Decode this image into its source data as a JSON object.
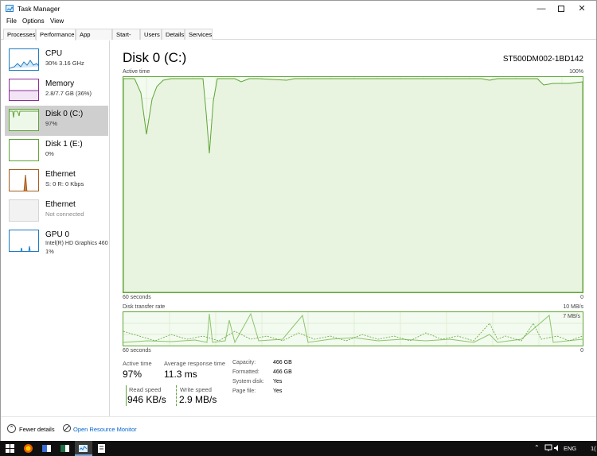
{
  "window": {
    "title": "Task Manager"
  },
  "menu": {
    "file": "File",
    "options": "Options",
    "view": "View"
  },
  "tabs": [
    "Processes",
    "Performance",
    "App history",
    "Start-up",
    "Users",
    "Details",
    "Services"
  ],
  "sidebar": {
    "items": [
      {
        "name": "CPU",
        "sub": "30%  3.16 GHz",
        "sub2": ""
      },
      {
        "name": "Memory",
        "sub": "2.8/7.7 GB (36%)",
        "sub2": ""
      },
      {
        "name": "Disk 0 (C:)",
        "sub": "97%",
        "sub2": ""
      },
      {
        "name": "Disk 1 (E:)",
        "sub": "0%",
        "sub2": ""
      },
      {
        "name": "Ethernet",
        "sub": "S: 0 R: 0 Kbps",
        "sub2": ""
      },
      {
        "name": "Ethernet",
        "sub": "Not connected",
        "sub2": ""
      },
      {
        "name": "GPU 0",
        "sub": "Intel(R) HD Graphics 460",
        "sub2": "1%"
      }
    ]
  },
  "main": {
    "title": "Disk 0 (C:)",
    "model": "ST500DM002-1BD142",
    "active_label": "Active time",
    "active_max": "100%",
    "seconds_left": "60 seconds",
    "zero": "0",
    "transfer_label": "Disk transfer rate",
    "transfer_max": "10 MB/s",
    "transfer_mid": "7 MB/s",
    "stats": {
      "active_time_label": "Active time",
      "active_time_value": "97%",
      "avg_response_label": "Average response time",
      "avg_response_value": "11.3 ms",
      "read_label": "Read speed",
      "read_value": "946 KB/s",
      "write_label": "Write speed",
      "write_value": "2.9 MB/s"
    },
    "specs": {
      "capacity_label": "Capacity:",
      "capacity_value": "466 GB",
      "formatted_label": "Formatted:",
      "formatted_value": "466 GB",
      "system_label": "System disk:",
      "system_value": "Yes",
      "pagefile_label": "Page file:",
      "pagefile_value": "Yes"
    }
  },
  "footer": {
    "fewer_details": "Fewer details",
    "open_monitor": "Open Resource Monitor"
  },
  "taskbar": {
    "lang": "ENG",
    "time_partial": "1("
  },
  "colors": {
    "disk_green": "#5fa536",
    "fill_green": "#f3faef",
    "link_blue": "#0066cc"
  }
}
